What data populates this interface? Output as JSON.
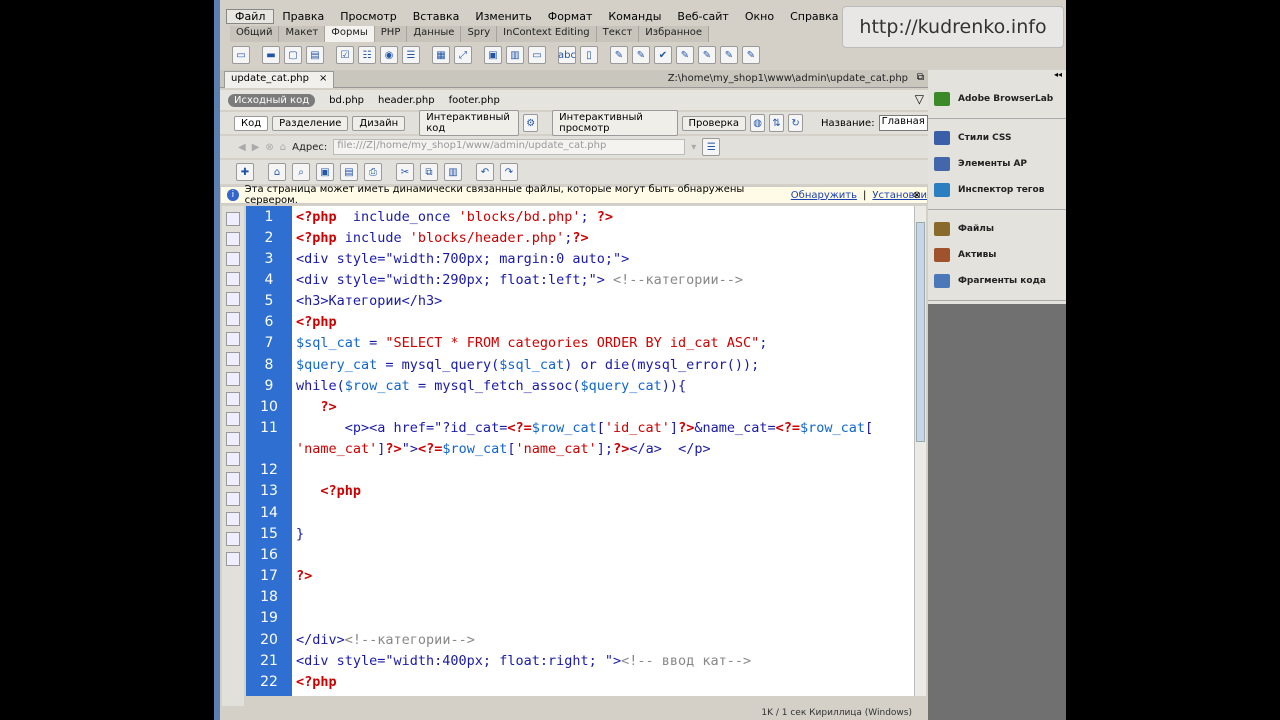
{
  "menu": [
    "Файл",
    "Правка",
    "Просмотр",
    "Вставка",
    "Изменить",
    "Формат",
    "Команды",
    "Веб-сайт",
    "Окно",
    "Справка"
  ],
  "watermark": "http://kudrenko.info",
  "insert_tabs": [
    "Общий",
    "Макет",
    "Формы",
    "PHP",
    "Данные",
    "Spry",
    "InContext Editing",
    "Текст",
    "Избранное"
  ],
  "document_tab": {
    "filename": "update_cat.php",
    "close": "×",
    "path": "Z:\\home\\my_shop1\\www\\admin\\update_cat.php",
    "restore": "⧉"
  },
  "related_files": {
    "source": "Исходный код",
    "files": [
      "bd.php",
      "header.php",
      "footer.php"
    ]
  },
  "doc_toolbar": {
    "views": [
      "Код",
      "Разделение",
      "Дизайн"
    ],
    "live_code": "Интерактивный код",
    "live_view": "Интерактивный просмотр",
    "inspect": "Проверка",
    "title_label": "Название:",
    "title_value": "Главная ст"
  },
  "address": {
    "label": "Адрес:",
    "value": "file:///Z|/home/my_shop1/www/admin/update_cat.php"
  },
  "infobar": {
    "text": "Эта страница может иметь динамически связанные файлы, которые могут быть обнаружены сервером.",
    "link1": "Обнаружить",
    "sep": "|",
    "link2": "Установки",
    "close": "⊗"
  },
  "code_lines": [
    {
      "n": "1",
      "html": "<span class=\"php\">&lt;?php</span>  include_once <span class=\"str\">'blocks/bd.php'</span>; <span class=\"php\">?&gt;</span>"
    },
    {
      "n": "2",
      "html": "<span class=\"php\">&lt;?php</span> include <span class=\"str\">'blocks/header.php'</span>;<span class=\"php\">?&gt;</span>"
    },
    {
      "n": "3",
      "html": "&lt;div style=\"width:700px; margin:0 auto;\"&gt;"
    },
    {
      "n": "4",
      "html": "&lt;div style=\"width:290px; float:left;\"&gt; <span class=\"cmt\">&lt;!--категории--&gt;</span>"
    },
    {
      "n": "5",
      "html": "&lt;h3&gt;Категории&lt;/h3&gt;"
    },
    {
      "n": "6",
      "html": "<span class=\"php\">&lt;?php</span>"
    },
    {
      "n": "7",
      "html": "<span class=\"var\">$sql_cat</span> = <span class=\"str\">\"SELECT * FROM categories ORDER BY id_cat ASC\"</span>;"
    },
    {
      "n": "8",
      "html": "<span class=\"var\">$query_cat</span> = mysql_query(<span class=\"var\">$sql_cat</span>) or die(mysql_error());"
    },
    {
      "n": "9",
      "html": "while(<span class=\"var\">$row_cat</span> = mysql_fetch_assoc(<span class=\"var\">$query_cat</span>)){"
    },
    {
      "n": "10",
      "html": "   <span class=\"php\">?&gt;</span>"
    },
    {
      "n": "11",
      "html": "      &lt;p&gt;&lt;a href=\"?id_cat=<span class=\"php\">&lt;?=</span><span class=\"var\">$row_cat</span>[<span class=\"str\">'id_cat'</span>]<span class=\"php\">?&gt;</span>&amp;name_cat=<span class=\"php\">&lt;?=</span><span class=\"var\">$row_cat</span>["
    },
    {
      "n": "",
      "html": "<span class=\"str\">'name_cat'</span>]<span class=\"php\">?&gt;</span>\"&gt;<span class=\"php\">&lt;?=</span><span class=\"var\">$row_cat</span>[<span class=\"str\">'name_cat'</span>];<span class=\"php\">?&gt;</span>&lt;/a&gt;  &lt;/p&gt;"
    },
    {
      "n": "12",
      "html": ""
    },
    {
      "n": "13",
      "html": "   <span class=\"php\">&lt;?php</span>"
    },
    {
      "n": "14",
      "html": ""
    },
    {
      "n": "15",
      "html": "}"
    },
    {
      "n": "16",
      "html": ""
    },
    {
      "n": "17",
      "html": "<span class=\"php\">?&gt;</span>"
    },
    {
      "n": "18",
      "html": ""
    },
    {
      "n": "19",
      "html": ""
    },
    {
      "n": "20",
      "html": "&lt;/div&gt;<span class=\"cmt\">&lt;!--категории--&gt;</span>"
    },
    {
      "n": "21",
      "html": "&lt;div style=\"width:400px; float:right; \"&gt;<span class=\"cmt\">&lt;!-- ввод кат--&gt;</span>"
    },
    {
      "n": "22",
      "html": "<span class=\"php\">&lt;?php</span>"
    }
  ],
  "status": "1K / 1 сек  Кириллица (Windows)",
  "panels": [
    [
      {
        "label": "Adobe BrowserLab",
        "color": "#3b8a2a"
      }
    ],
    [
      {
        "label": "Стили CSS",
        "color": "#3a5fa8"
      },
      {
        "label": "Элементы AP",
        "color": "#4466aa"
      },
      {
        "label": "Инспектор тегов",
        "color": "#2a7fc0"
      }
    ],
    [
      {
        "label": "Файлы",
        "color": "#8a6a2a"
      },
      {
        "label": "Активы",
        "color": "#a0522d"
      },
      {
        "label": "Фрагменты кода",
        "color": "#4a78b8"
      }
    ]
  ]
}
